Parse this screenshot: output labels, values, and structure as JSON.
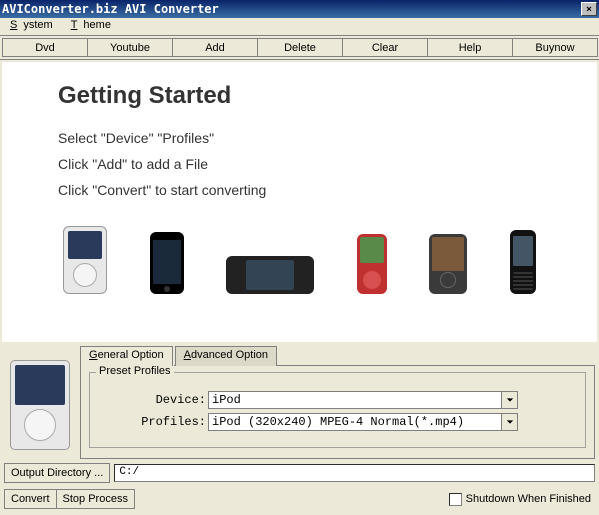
{
  "window": {
    "title": "AVIConverter.biz AVI Converter"
  },
  "menu": {
    "system": "System",
    "theme": "Theme"
  },
  "toolbar": [
    "Dvd",
    "Youtube",
    "Add",
    "Delete",
    "Clear",
    "Help",
    "Buynow"
  ],
  "main": {
    "heading": "Getting Started",
    "step1": "Select \"Device\" \"Profiles\"",
    "step2": "Click  \"Add\" to add a File",
    "step3": "Click  \"Convert\" to start converting"
  },
  "tabs": {
    "general": "General Option",
    "advanced": "Advanced Option"
  },
  "preset": {
    "legend": "Preset Profiles",
    "device_label": "Device:",
    "device_value": "iPod",
    "profiles_label": "Profiles:",
    "profiles_value": "iPod (320x240) MPEG-4 Normal(*.mp4)"
  },
  "output": {
    "button": "Output Directory ...",
    "path": "C:/"
  },
  "bottom": {
    "convert": "Convert",
    "stop": "Stop Process",
    "shutdown": "Shutdown When Finished"
  }
}
